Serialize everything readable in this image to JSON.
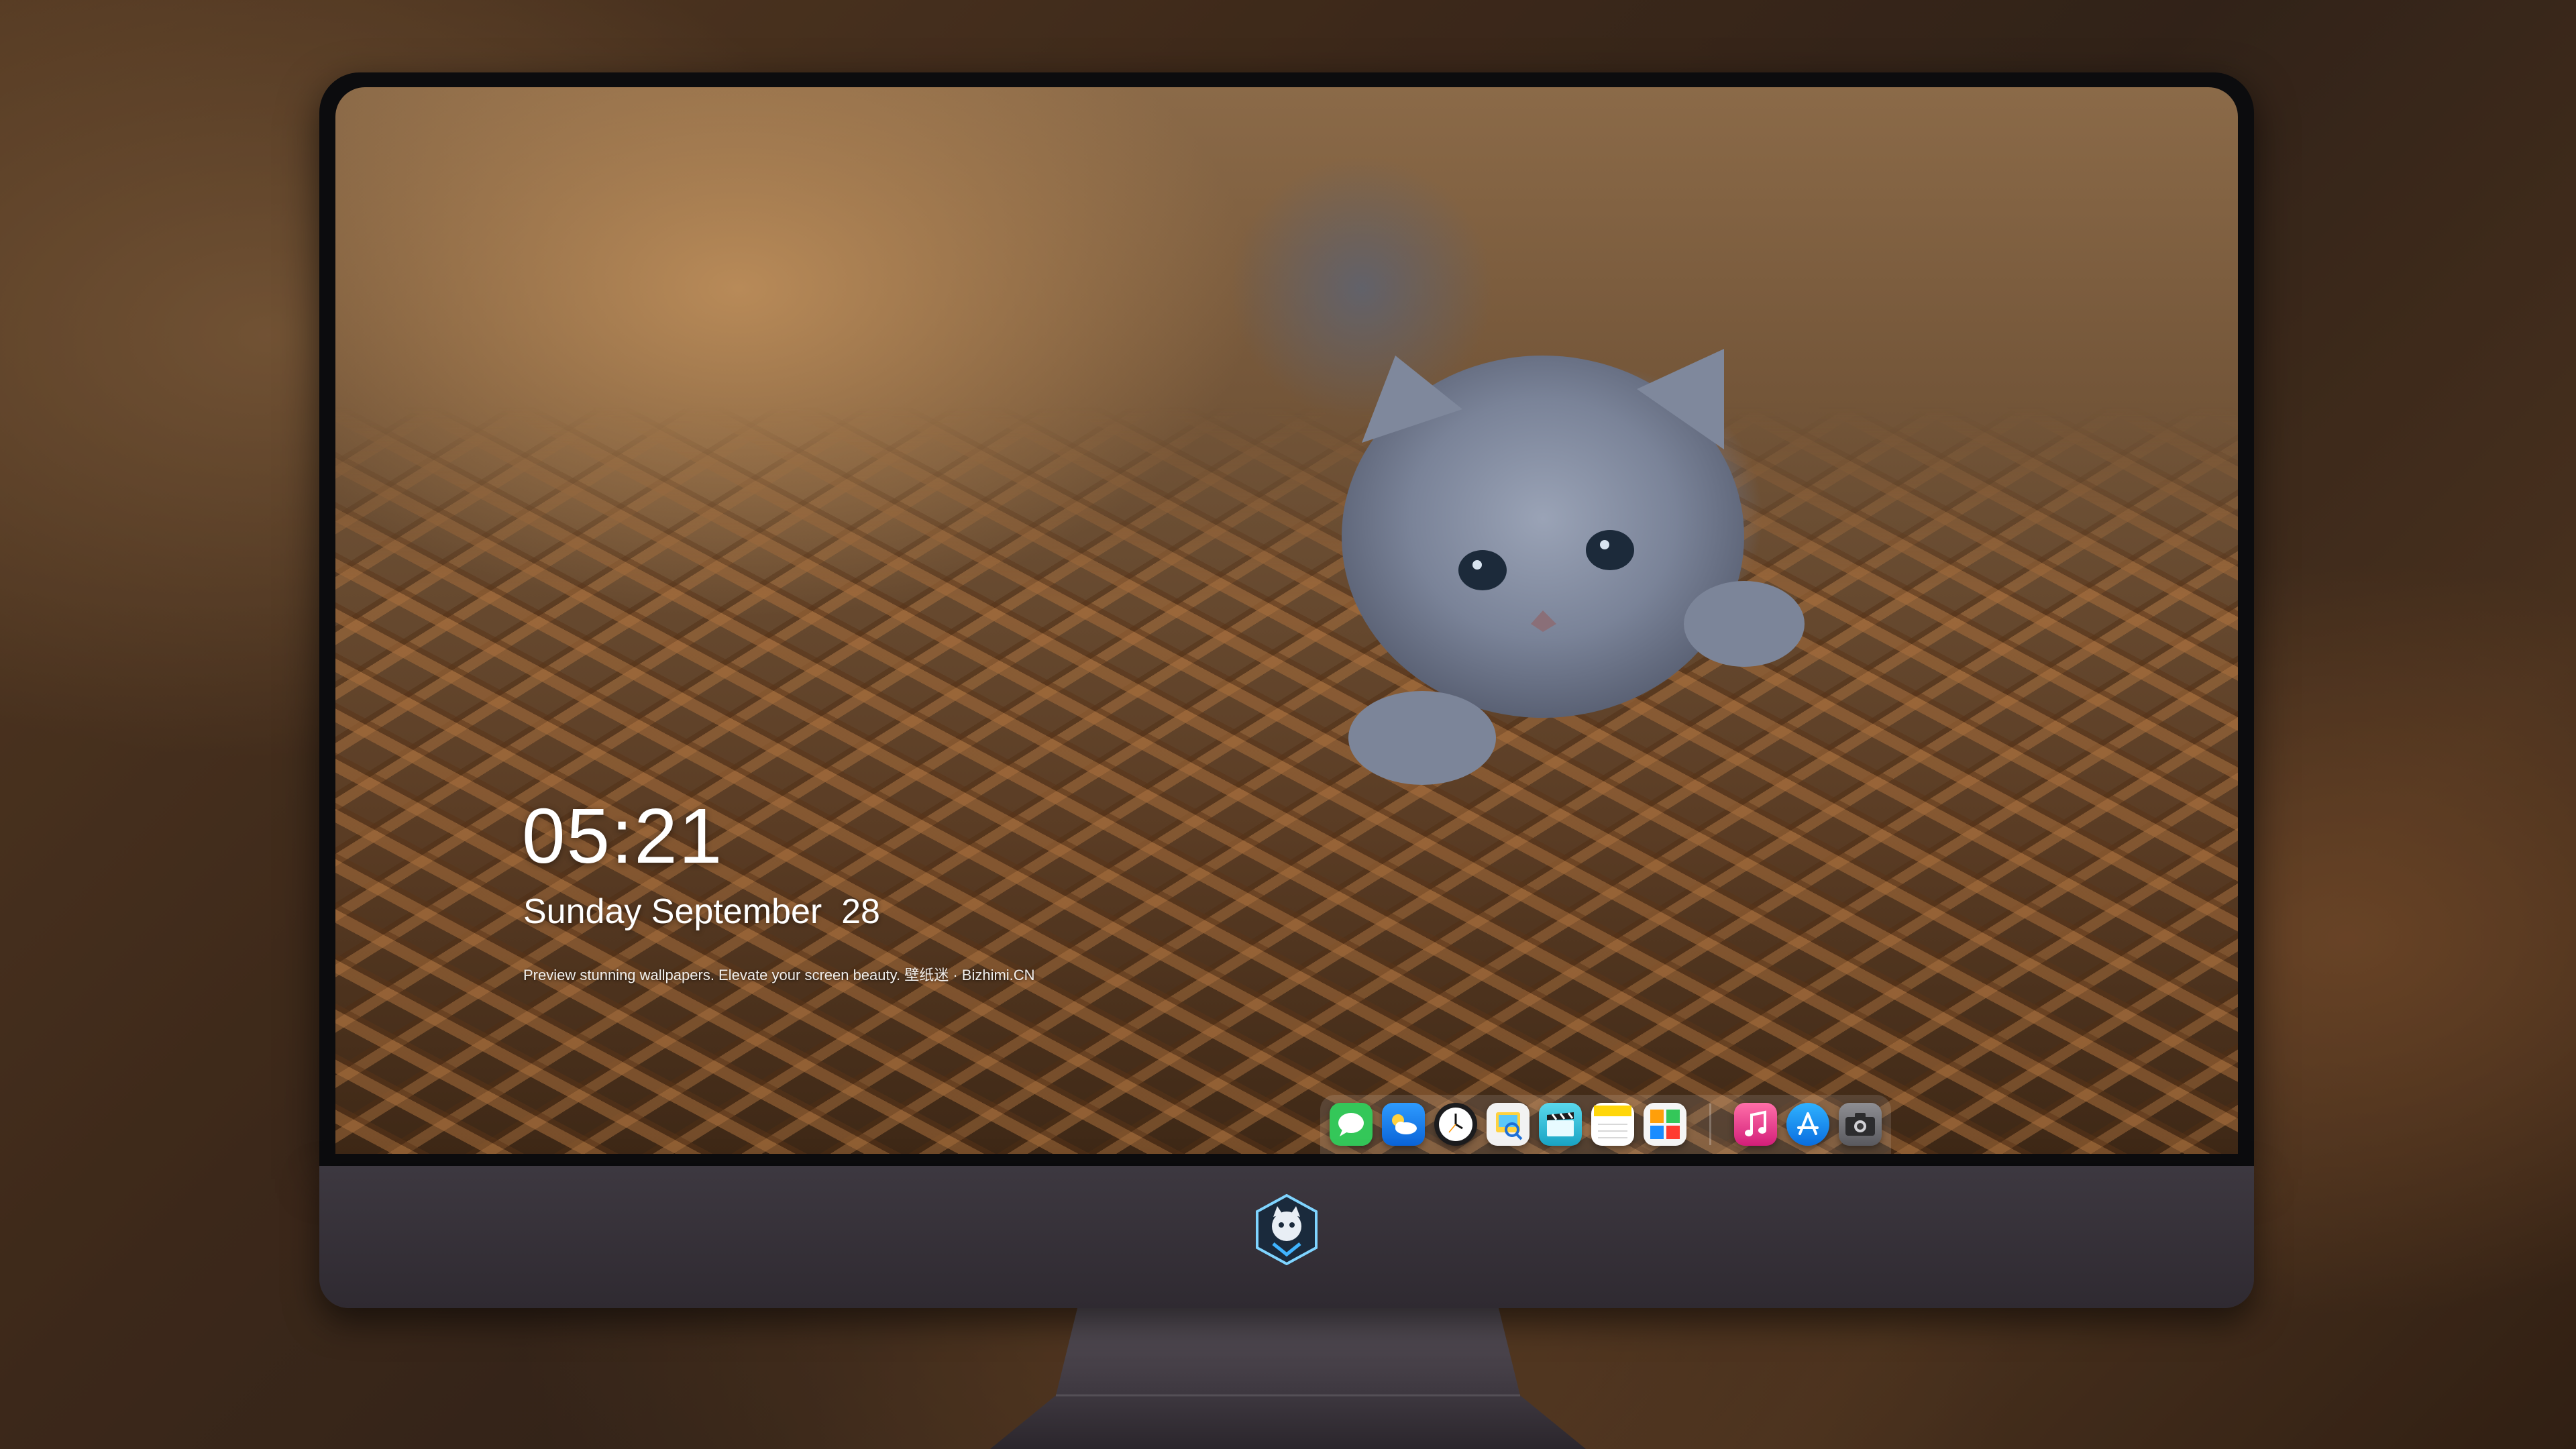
{
  "lockscreen": {
    "time": "05:21",
    "date": "Sunday September  28",
    "tagline": "Preview stunning wallpapers. Elevate your screen beauty. 壁纸迷 · Bizhimi.CN"
  },
  "dock": {
    "apps": [
      {
        "icon": "messages-icon",
        "color": "#34c759"
      },
      {
        "icon": "weather-icon",
        "color": "#1e90ff"
      },
      {
        "icon": "clock-icon",
        "color": "#1c1c1e"
      },
      {
        "icon": "preview-icon",
        "color": "#f2f2f2"
      },
      {
        "icon": "video-editor-icon",
        "color": "#34c1d8"
      },
      {
        "icon": "notes-icon",
        "color": "#ffd60a"
      },
      {
        "icon": "photo-booth-icon",
        "color": "#ff9f0a"
      },
      {
        "icon": "music-icon",
        "color": "#fa2d78"
      },
      {
        "icon": "app-store-icon",
        "color": "#1a8cff"
      },
      {
        "icon": "camera-icon",
        "color": "#6e6e73"
      }
    ]
  },
  "colors": {
    "bezel": "#0c0c0e",
    "chin": "#3d3840",
    "stand": "#4a444c"
  }
}
